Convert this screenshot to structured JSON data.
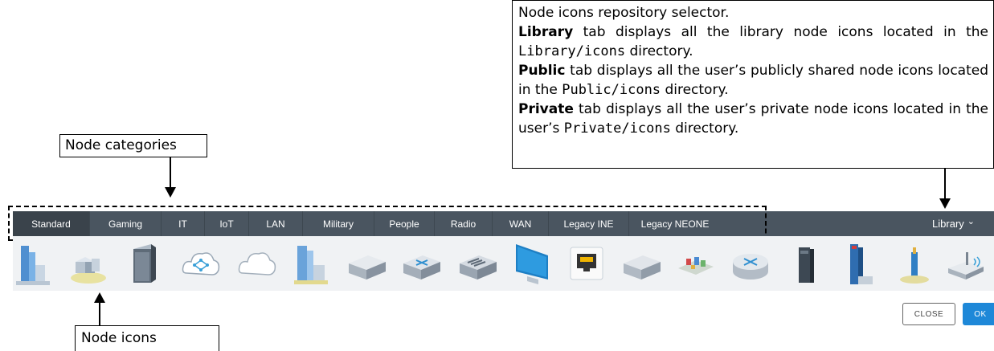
{
  "callouts": {
    "repository": {
      "line1": "Node icons repository selector.",
      "library_bold": "Library",
      "library_text": " tab displays all the library node icons located in the ",
      "library_path": "Library/icons",
      "library_tail": " directory.",
      "public_bold": "Public",
      "public_text": " tab displays all the user’s publicly shared node icons located in the ",
      "public_path": "Public/icons",
      "public_tail": " directory.",
      "private_bold": "Private",
      "private_text": " tab displays all the user’s private node icons located in the user’s ",
      "private_path": "Private/icons",
      "private_tail": " directory."
    },
    "categories": "Node categories",
    "icons": "Node icons"
  },
  "toolbar": {
    "tabs": [
      {
        "label": "Standard",
        "active": true
      },
      {
        "label": "Gaming"
      },
      {
        "label": "IT"
      },
      {
        "label": "IoT"
      },
      {
        "label": "LAN"
      },
      {
        "label": "Military"
      },
      {
        "label": "People"
      },
      {
        "label": "Radio"
      },
      {
        "label": "WAN"
      },
      {
        "label": "Legacy INE"
      },
      {
        "label": "Legacy NEONE"
      }
    ],
    "repository_label": "Library",
    "repository_chevron": "⌄"
  },
  "icons": [
    "city-towers-icon",
    "campus-buildings-icon",
    "server-cabinet-icon",
    "cloud-network-icon",
    "cloud-icon",
    "office-buildings-icon",
    "appliance-box-icon",
    "router-box-icon",
    "switch-box-icon",
    "monitor-icon",
    "ethernet-port-icon",
    "grey-box-icon",
    "smart-city-icon",
    "round-router-icon",
    "tower-server-icon",
    "skyscraper-icon",
    "cell-tower-icon",
    "wireless-router-icon"
  ],
  "buttons": {
    "close": "CLOSE",
    "ok": "OK"
  },
  "colors": {
    "toolbar_bg": "#4a5560",
    "active_tab_bg": "#3a434b",
    "strip_bg": "#f0f2f4",
    "ok_button": "#1e88d8"
  }
}
